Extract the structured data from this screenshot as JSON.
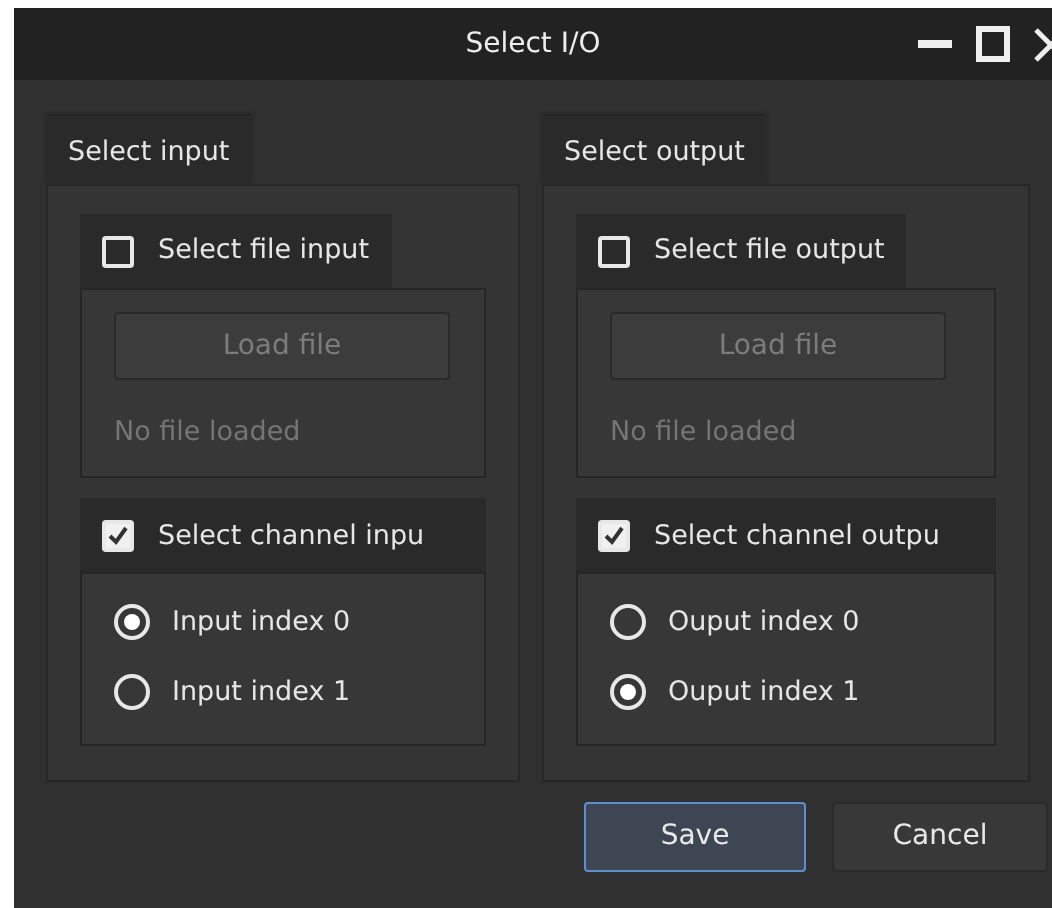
{
  "window": {
    "title": "Select I/O"
  },
  "groups": [
    {
      "title": "Select input",
      "file_section": {
        "label": "Select file input",
        "checked": false,
        "button": "Load file",
        "disabled": true,
        "status": "No file loaded"
      },
      "channel_section": {
        "label": "Select channel inpu",
        "checked": true,
        "options": [
          {
            "label": "Input index 0",
            "selected": true
          },
          {
            "label": "Input index 1",
            "selected": false
          }
        ]
      }
    },
    {
      "title": "Select output",
      "file_section": {
        "label": "Select file output",
        "checked": false,
        "button": "Load file",
        "disabled": true,
        "status": "No file loaded"
      },
      "channel_section": {
        "label": "Select channel outpu",
        "checked": true,
        "options": [
          {
            "label": "Ouput index 0",
            "selected": false
          },
          {
            "label": "Ouput index 1",
            "selected": true
          }
        ]
      }
    }
  ],
  "buttons": [
    {
      "label": "Save",
      "default": true
    },
    {
      "label": "Cancel",
      "default": false
    }
  ]
}
